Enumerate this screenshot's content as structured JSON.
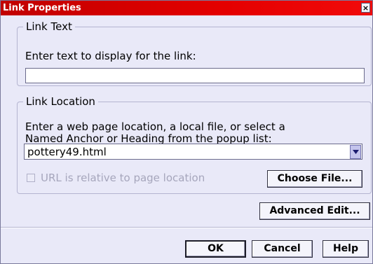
{
  "window": {
    "title": "Link Properties",
    "close_glyph": "×"
  },
  "link_text": {
    "legend": "Link Text",
    "prompt": "Enter text to display for the link:",
    "value": ""
  },
  "link_location": {
    "legend": "Link Location",
    "prompt_line1": "Enter a web page location, a local file, or select a",
    "prompt_line2": "Named Anchor or Heading from the popup list:",
    "url_value": "pottery49.html",
    "relative_checkbox_label": "URL is relative to page location",
    "relative_checked": false,
    "choose_file_label": "Choose File..."
  },
  "buttons": {
    "advanced_edit": "Advanced Edit...",
    "ok": "OK",
    "cancel": "Cancel",
    "help": "Help"
  },
  "colors": {
    "titlebar": "#d40000",
    "dialog_bg": "#e9e9f8",
    "disabled_text": "#a6a6bc"
  },
  "icons": {
    "close": "close-icon",
    "dropdown": "chevron-down-icon"
  }
}
